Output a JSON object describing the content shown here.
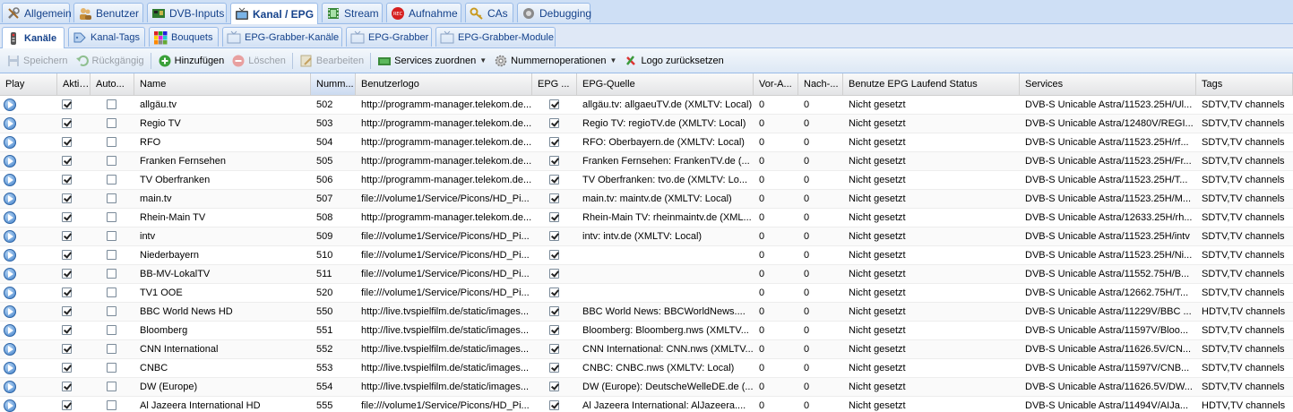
{
  "main_tabs": [
    {
      "label": "Allgemein",
      "icon": "wrench-icon"
    },
    {
      "label": "Benutzer",
      "icon": "users-icon"
    },
    {
      "label": "DVB-Inputs",
      "icon": "tuner-card-icon"
    },
    {
      "label": "Kanal / EPG",
      "icon": "tv-icon",
      "active": true
    },
    {
      "label": "Stream",
      "icon": "film-icon"
    },
    {
      "label": "Aufnahme",
      "icon": "record-icon"
    },
    {
      "label": "CAs",
      "icon": "key-icon"
    },
    {
      "label": "Debugging",
      "icon": "bug-icon"
    }
  ],
  "sub_tabs": [
    {
      "label": "Kanäle",
      "icon": "remote-icon",
      "active": true
    },
    {
      "label": "Kanal-Tags",
      "icon": "tag-icon"
    },
    {
      "label": "Bouquets",
      "icon": "colors-icon"
    },
    {
      "label": "EPG-Grabber-Kanäle",
      "icon": "epg-icon"
    },
    {
      "label": "EPG-Grabber",
      "icon": "epg-icon"
    },
    {
      "label": "EPG-Grabber-Module",
      "icon": "epg-icon"
    }
  ],
  "toolbar": {
    "save": "Speichern",
    "undo": "Rückgängig",
    "add": "Hinzufügen",
    "delete": "Löschen",
    "edit": "Bearbeiten",
    "map_services": "Services zuordnen",
    "number_ops": "Nummernoperationen",
    "reset_logo": "Logo zurücksetzen"
  },
  "columns": [
    "Play",
    "Aktiviert",
    "Auto...",
    "Name",
    "Numm...",
    "Benutzerlogo",
    "EPG ...",
    "EPG-Quelle",
    "Vor-A...",
    "Nach-...",
    "Benutze EPG Laufend Status",
    "Services",
    "Tags"
  ],
  "rows": [
    {
      "enabled": true,
      "auto": false,
      "name": "allgäu.tv",
      "number": "502",
      "logo": "http://programm-manager.telekom.de...",
      "epg": true,
      "epg_source": "allgäu.tv: allgaeuTV.de (XMLTV: Local)",
      "pre": "0",
      "post": "0",
      "status": "Nicht gesetzt",
      "services": "DVB-S Unicable Astra/11523.25H/Ul...",
      "tags": "SDTV,TV channels"
    },
    {
      "enabled": true,
      "auto": false,
      "name": "Regio TV",
      "number": "503",
      "logo": "http://programm-manager.telekom.de...",
      "epg": true,
      "epg_source": "Regio TV: regioTV.de (XMLTV: Local)",
      "pre": "0",
      "post": "0",
      "status": "Nicht gesetzt",
      "services": "DVB-S Unicable Astra/12480V/REGI...",
      "tags": "SDTV,TV channels"
    },
    {
      "enabled": true,
      "auto": false,
      "name": "RFO",
      "number": "504",
      "logo": "http://programm-manager.telekom.de...",
      "epg": true,
      "epg_source": "RFO: Oberbayern.de (XMLTV: Local)",
      "pre": "0",
      "post": "0",
      "status": "Nicht gesetzt",
      "services": "DVB-S Unicable Astra/11523.25H/rf...",
      "tags": "SDTV,TV channels"
    },
    {
      "enabled": true,
      "auto": false,
      "name": "Franken Fernsehen",
      "number": "505",
      "logo": "http://programm-manager.telekom.de...",
      "epg": true,
      "epg_source": "Franken Fernsehen: FrankenTV.de (...",
      "pre": "0",
      "post": "0",
      "status": "Nicht gesetzt",
      "services": "DVB-S Unicable Astra/11523.25H/Fr...",
      "tags": "SDTV,TV channels"
    },
    {
      "enabled": true,
      "auto": false,
      "name": "TV Oberfranken",
      "number": "506",
      "logo": "http://programm-manager.telekom.de...",
      "epg": true,
      "epg_source": "TV Oberfranken: tvo.de (XMLTV: Lo...",
      "pre": "0",
      "post": "0",
      "status": "Nicht gesetzt",
      "services": "DVB-S Unicable Astra/11523.25H/T...",
      "tags": "SDTV,TV channels"
    },
    {
      "enabled": true,
      "auto": false,
      "name": "main.tv",
      "number": "507",
      "logo": "file:///volume1/Service/Picons/HD_Pi...",
      "epg": true,
      "epg_source": "main.tv: maintv.de (XMLTV: Local)",
      "pre": "0",
      "post": "0",
      "status": "Nicht gesetzt",
      "services": "DVB-S Unicable Astra/11523.25H/M...",
      "tags": "SDTV,TV channels"
    },
    {
      "enabled": true,
      "auto": false,
      "name": "Rhein-Main TV",
      "number": "508",
      "logo": "http://programm-manager.telekom.de...",
      "epg": true,
      "epg_source": "Rhein-Main TV: rheinmaintv.de (XML...",
      "pre": "0",
      "post": "0",
      "status": "Nicht gesetzt",
      "services": "DVB-S Unicable Astra/12633.25H/rh...",
      "tags": "SDTV,TV channels"
    },
    {
      "enabled": true,
      "auto": false,
      "name": "intv",
      "number": "509",
      "logo": "file:///volume1/Service/Picons/HD_Pi...",
      "epg": true,
      "epg_source": "intv: intv.de (XMLTV: Local)",
      "pre": "0",
      "post": "0",
      "status": "Nicht gesetzt",
      "services": "DVB-S Unicable Astra/11523.25H/intv",
      "tags": "SDTV,TV channels"
    },
    {
      "enabled": true,
      "auto": false,
      "name": "Niederbayern",
      "number": "510",
      "logo": "file:///volume1/Service/Picons/HD_Pi...",
      "epg": true,
      "epg_source": "",
      "pre": "0",
      "post": "0",
      "status": "Nicht gesetzt",
      "services": "DVB-S Unicable Astra/11523.25H/Ni...",
      "tags": "SDTV,TV channels"
    },
    {
      "enabled": true,
      "auto": false,
      "name": "BB-MV-LokalTV",
      "number": "511",
      "logo": "file:///volume1/Service/Picons/HD_Pi...",
      "epg": true,
      "epg_source": "",
      "pre": "0",
      "post": "0",
      "status": "Nicht gesetzt",
      "services": "DVB-S Unicable Astra/11552.75H/B...",
      "tags": "SDTV,TV channels"
    },
    {
      "enabled": true,
      "auto": false,
      "name": "TV1 OOE",
      "number": "520",
      "logo": "file:///volume1/Service/Picons/HD_Pi...",
      "epg": true,
      "epg_source": "",
      "pre": "0",
      "post": "0",
      "status": "Nicht gesetzt",
      "services": "DVB-S Unicable Astra/12662.75H/T...",
      "tags": "SDTV,TV channels"
    },
    {
      "enabled": true,
      "auto": false,
      "name": "BBC World News HD",
      "number": "550",
      "logo": "http://live.tvspielfilm.de/static/images...",
      "epg": true,
      "epg_source": "BBC World News: BBCWorldNews....",
      "pre": "0",
      "post": "0",
      "status": "Nicht gesetzt",
      "services": "DVB-S Unicable Astra/11229V/BBC ...",
      "tags": "HDTV,TV channels"
    },
    {
      "enabled": true,
      "auto": false,
      "name": "Bloomberg",
      "number": "551",
      "logo": "http://live.tvspielfilm.de/static/images...",
      "epg": true,
      "epg_source": "Bloomberg: Bloomberg.nws (XMLTV...",
      "pre": "0",
      "post": "0",
      "status": "Nicht gesetzt",
      "services": "DVB-S Unicable Astra/11597V/Bloo...",
      "tags": "SDTV,TV channels"
    },
    {
      "enabled": true,
      "auto": false,
      "name": "CNN International",
      "number": "552",
      "logo": "http://live.tvspielfilm.de/static/images...",
      "epg": true,
      "epg_source": "CNN International: CNN.nws (XMLTV...",
      "pre": "0",
      "post": "0",
      "status": "Nicht gesetzt",
      "services": "DVB-S Unicable Astra/11626.5V/CN...",
      "tags": "SDTV,TV channels"
    },
    {
      "enabled": true,
      "auto": false,
      "name": "CNBC",
      "number": "553",
      "logo": "http://live.tvspielfilm.de/static/images...",
      "epg": true,
      "epg_source": "CNBC: CNBC.nws (XMLTV: Local)",
      "pre": "0",
      "post": "0",
      "status": "Nicht gesetzt",
      "services": "DVB-S Unicable Astra/11597V/CNB...",
      "tags": "SDTV,TV channels"
    },
    {
      "enabled": true,
      "auto": false,
      "name": "DW (Europe)",
      "number": "554",
      "logo": "http://live.tvspielfilm.de/static/images...",
      "epg": true,
      "epg_source": "DW (Europe): DeutscheWelleDE.de (...",
      "pre": "0",
      "post": "0",
      "status": "Nicht gesetzt",
      "services": "DVB-S Unicable Astra/11626.5V/DW...",
      "tags": "SDTV,TV channels"
    },
    {
      "enabled": true,
      "auto": false,
      "name": "Al Jazeera International HD",
      "number": "555",
      "logo": "file:///volume1/Service/Picons/HD_Pi...",
      "epg": true,
      "epg_source": "Al Jazeera International: AlJazeera....",
      "pre": "0",
      "post": "0",
      "status": "Nicht gesetzt",
      "services": "DVB-S Unicable Astra/11494V/AIJa...",
      "tags": "HDTV,TV channels"
    }
  ]
}
